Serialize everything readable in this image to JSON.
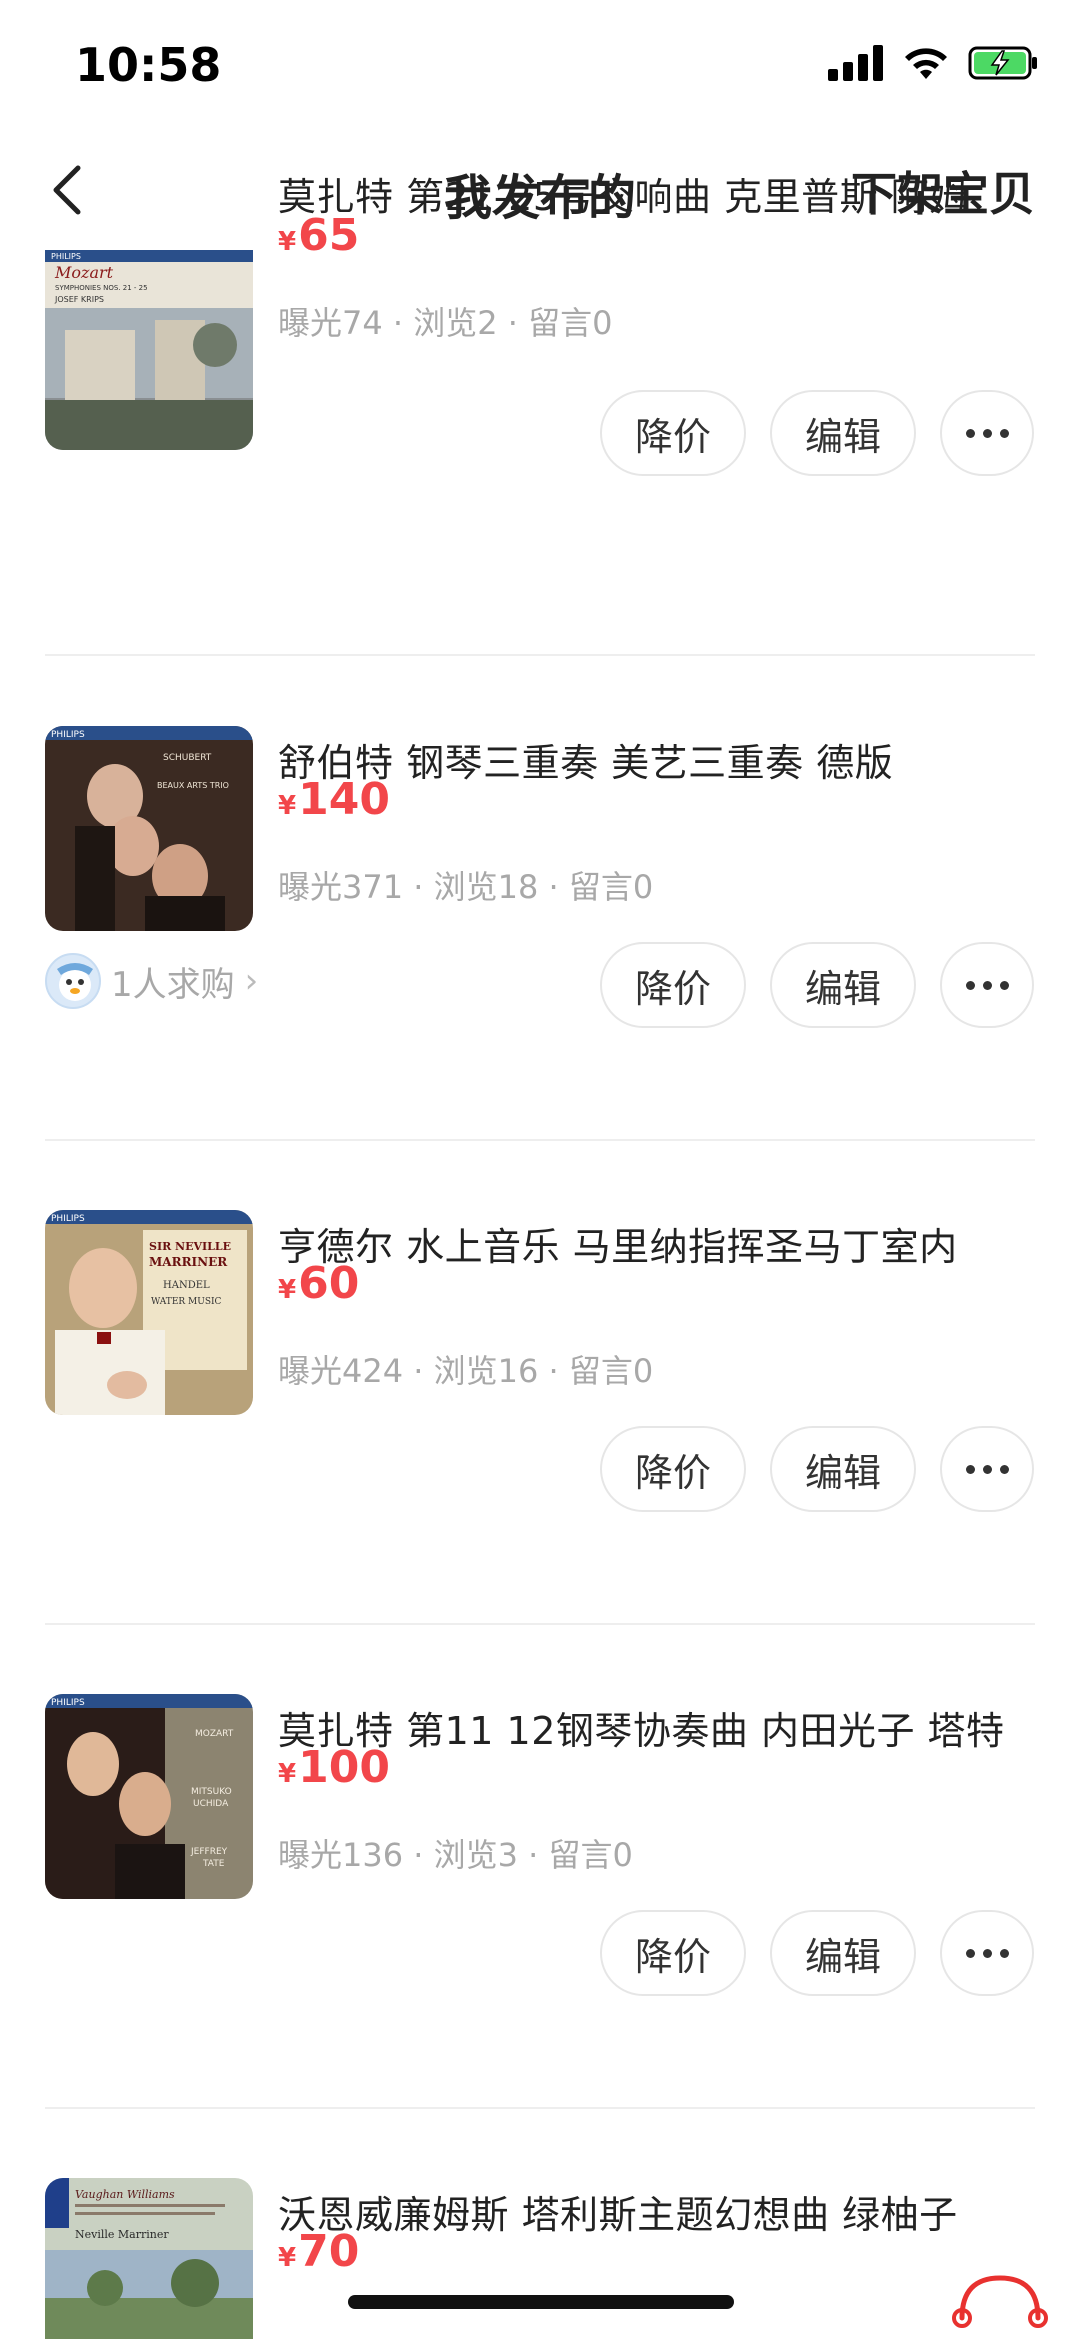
{
  "status": {
    "time": "10:58"
  },
  "nav": {
    "title": "我发布的",
    "action": "下架宝贝"
  },
  "buttons": {
    "reduce": "降价",
    "edit": "编辑"
  },
  "items": [
    {
      "title": "莫扎特 第21-25号交响曲 克里普斯 阿姆",
      "currency": "¥",
      "price": "65",
      "stats": "曝光74 · 浏览2 · 留言0",
      "thumb_text": [
        "PHILIPS",
        "Mozart",
        "SYMPHONIES NOS. 21 - 25",
        "JOSEF KRIPS"
      ]
    },
    {
      "title": "舒伯特 钢琴三重奏 美艺三重奏 德版",
      "currency": "¥",
      "price": "140",
      "stats": "曝光371 · 浏览18 · 留言0",
      "buyer": "1人求购",
      "thumb_text": [
        "PHILIPS",
        "SCHUBERT",
        "BEAUX ARTS TRIO"
      ]
    },
    {
      "title": "亨德尔 水上音乐 马里纳指挥圣马丁室内",
      "currency": "¥",
      "price": "60",
      "stats": "曝光424 · 浏览16 · 留言0",
      "thumb_text": [
        "PHILIPS",
        "SIR NEVILLE",
        "MARRINER",
        "HANDEL",
        "WATER MUSIC"
      ]
    },
    {
      "title": "莫扎特 第11 12钢琴协奏曲 内田光子 塔特",
      "currency": "¥",
      "price": "100",
      "stats": "曝光136 · 浏览3 · 留言0",
      "thumb_text": [
        "PHILIPS",
        "MOZART",
        "MITSUKO",
        "UCHIDA",
        "JEFFREY",
        "TATE"
      ]
    },
    {
      "title": "沃恩威廉姆斯 塔利斯主题幻想曲 绿柚子",
      "currency": "¥",
      "price": "70",
      "thumb_text": [
        "Vaughan Williams",
        "Neville Marriner"
      ]
    }
  ]
}
